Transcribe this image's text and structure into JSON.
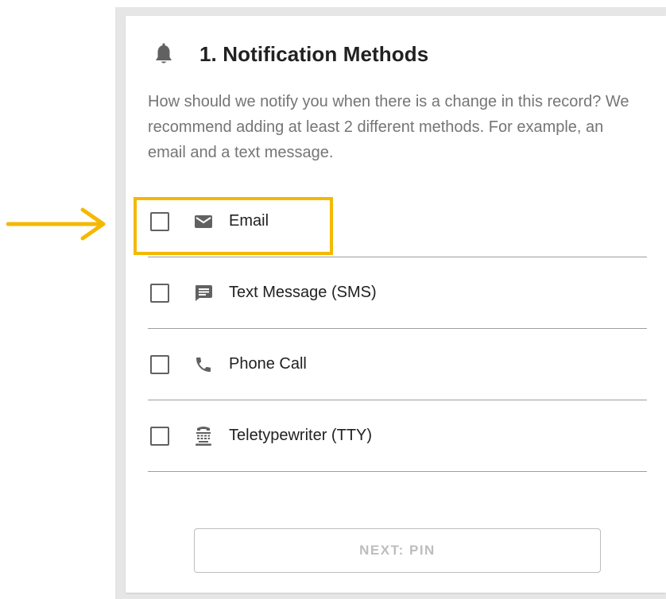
{
  "header": {
    "icon": "bell-icon",
    "title": "1. Notification Methods"
  },
  "description": "How should we notify you when there is a change in this record? We recommend adding at least 2 different methods. For example, an email and a text message.",
  "methods": [
    {
      "label": "Email",
      "icon": "email-icon",
      "checked": false
    },
    {
      "label": "Text Message (SMS)",
      "icon": "sms-icon",
      "checked": false
    },
    {
      "label": "Phone Call",
      "icon": "phone-icon",
      "checked": false
    },
    {
      "label": "Teletypewriter (TTY)",
      "icon": "tty-icon",
      "checked": false
    }
  ],
  "next_button": {
    "label": "NEXT: PIN",
    "enabled": false
  },
  "annotation": {
    "highlighted_item": "Email",
    "color": "#f5b800"
  },
  "colors": {
    "icon": "#616161",
    "title": "#212121",
    "description": "#757575",
    "disabled": "#bdbdbd"
  }
}
